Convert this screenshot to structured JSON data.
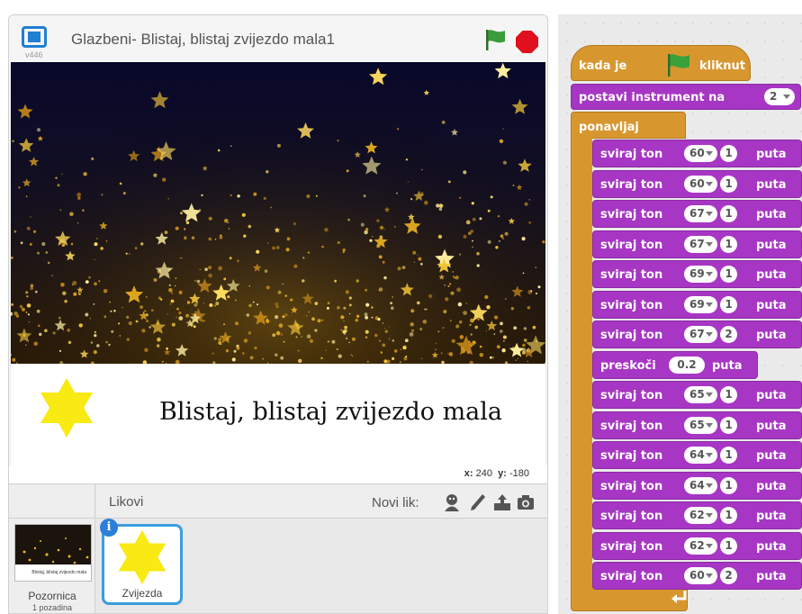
{
  "stage": {
    "version": "v446",
    "title": "Glazbeni- Blistaj, blistaj zvijezdo mala1",
    "caption": "Blistaj, blistaj zvijezdo mala",
    "coords": {
      "x_label": "x:",
      "x_value": "240",
      "y_label": "y:",
      "y_value": "-180"
    }
  },
  "sprites": {
    "heading": "Likovi",
    "new_sprite_label": "Novi lik:",
    "stage_item": {
      "label": "Pozornica",
      "sublabel": "1 pozadina",
      "thumb_text": "Blistaj, blistaj zvijezdo mala"
    },
    "items": [
      {
        "name": "Zvijezda"
      }
    ],
    "info_icon_glyph": "i"
  },
  "colors": {
    "events": "#d8972e",
    "sound": "#a736c4",
    "sprite_selected": "#3a9ddc",
    "flag_green": "#2e8b3a",
    "stop_red": "#e0101e"
  },
  "icons": [
    "fullscreen-icon",
    "green-flag-icon",
    "stop-icon",
    "sprite-library-icon",
    "paint-icon",
    "upload-icon",
    "camera-icon",
    "info-icon",
    "loop-arrow-icon"
  ],
  "script": {
    "hat": {
      "before": "kada je",
      "after": "kliknut"
    },
    "set_instrument": {
      "label": "postavi instrument na",
      "value": "2"
    },
    "loop_label": "ponavljaj",
    "note_label": "sviraj ton",
    "beats_label": "puta",
    "rest_label": "preskoči",
    "blocks": [
      {
        "type": "note",
        "note": "60",
        "beats": "1"
      },
      {
        "type": "note",
        "note": "60",
        "beats": "1"
      },
      {
        "type": "note",
        "note": "67",
        "beats": "1"
      },
      {
        "type": "note",
        "note": "67",
        "beats": "1"
      },
      {
        "type": "note",
        "note": "69",
        "beats": "1"
      },
      {
        "type": "note",
        "note": "69",
        "beats": "1"
      },
      {
        "type": "note",
        "note": "67",
        "beats": "2"
      },
      {
        "type": "rest",
        "beats": "0.2"
      },
      {
        "type": "note",
        "note": "65",
        "beats": "1"
      },
      {
        "type": "note",
        "note": "65",
        "beats": "1"
      },
      {
        "type": "note",
        "note": "64",
        "beats": "1"
      },
      {
        "type": "note",
        "note": "64",
        "beats": "1"
      },
      {
        "type": "note",
        "note": "62",
        "beats": "1"
      },
      {
        "type": "note",
        "note": "62",
        "beats": "1"
      },
      {
        "type": "note",
        "note": "60",
        "beats": "2"
      }
    ]
  }
}
